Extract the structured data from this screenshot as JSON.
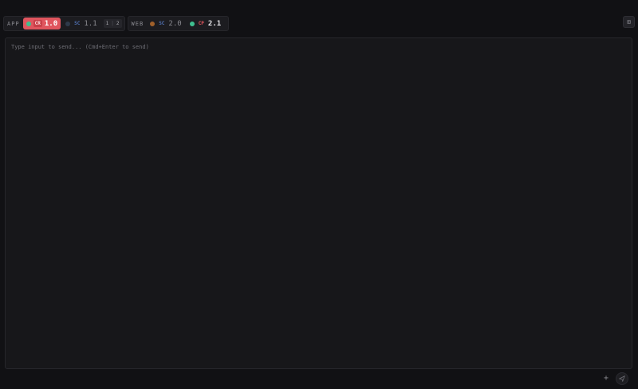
{
  "toolbar": {
    "groups": [
      {
        "label": "APP",
        "tabs": [
          {
            "tag": "CR",
            "version": "1.0",
            "dot_color": "#3fbf8f",
            "tag_color": "#e0555e",
            "active": true
          },
          {
            "tag": "SC",
            "version": "1.1",
            "dot_color": "#2e3a4a",
            "tag_color": "#4f6fb0",
            "active": false
          }
        ],
        "split": {
          "left": "1",
          "right": "2"
        }
      },
      {
        "label": "WEB",
        "tabs": [
          {
            "tag": "SC",
            "version": "2.0",
            "dot_color": "#a0602a",
            "tag_color": "#4f6fb0",
            "active": false
          },
          {
            "tag": "CP",
            "version": "2.1",
            "dot_color": "#3fbf8f",
            "tag_color": "#e0555e",
            "active": false
          }
        ]
      }
    ]
  },
  "corner_button": {
    "icon": "grid-icon",
    "glyph": "⊞"
  },
  "editor": {
    "placeholder": "Type input to send... (Cmd+Enter to send)",
    "value": ""
  },
  "footer": {
    "add_glyph": "+",
    "send_icon": "send-icon"
  }
}
